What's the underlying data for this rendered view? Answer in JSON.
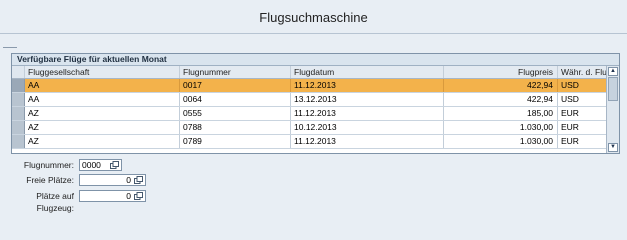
{
  "page": {
    "title": "Flugsuchmaschine"
  },
  "table": {
    "caption": "Verfügbare Flüge für aktuellen Monat",
    "headers": {
      "airline": "Fluggesellschaft",
      "flight_no": "Flugnummer",
      "date": "Flugdatum",
      "price": "Flugpreis",
      "currency": "Währ. d. Flugg."
    },
    "rows": [
      {
        "airline": "AA",
        "flight_no": "0017",
        "date": "11.12.2013",
        "price": "422,94",
        "currency": "USD",
        "selected": true
      },
      {
        "airline": "AA",
        "flight_no": "0064",
        "date": "13.12.2013",
        "price": "422,94",
        "currency": "USD",
        "selected": false
      },
      {
        "airline": "AZ",
        "flight_no": "0555",
        "date": "11.12.2013",
        "price": "185,00",
        "currency": "EUR",
        "selected": false
      },
      {
        "airline": "AZ",
        "flight_no": "0788",
        "date": "10.12.2013",
        "price": "1.030,00",
        "currency": "EUR",
        "selected": false
      },
      {
        "airline": "AZ",
        "flight_no": "0789",
        "date": "11.12.2013",
        "price": "1.030,00",
        "currency": "EUR",
        "selected": false
      }
    ],
    "scroll_up_icon": "triangle-up-icon",
    "scroll_down_icon": "triangle-down-icon"
  },
  "form": {
    "flight_no_label": "Flugnummer:",
    "flight_no_value": "0000",
    "free_seats_label": "Freie Plätze:",
    "free_seats_value": "0",
    "seats_label": "Plätze auf Flugzeug:",
    "seats_value": "0",
    "value_help_icon": "value-help-icon"
  },
  "colors": {
    "selected_row": "#f3b24b",
    "background": "#e8eef4",
    "caption_bg": "#d9e4ee"
  }
}
